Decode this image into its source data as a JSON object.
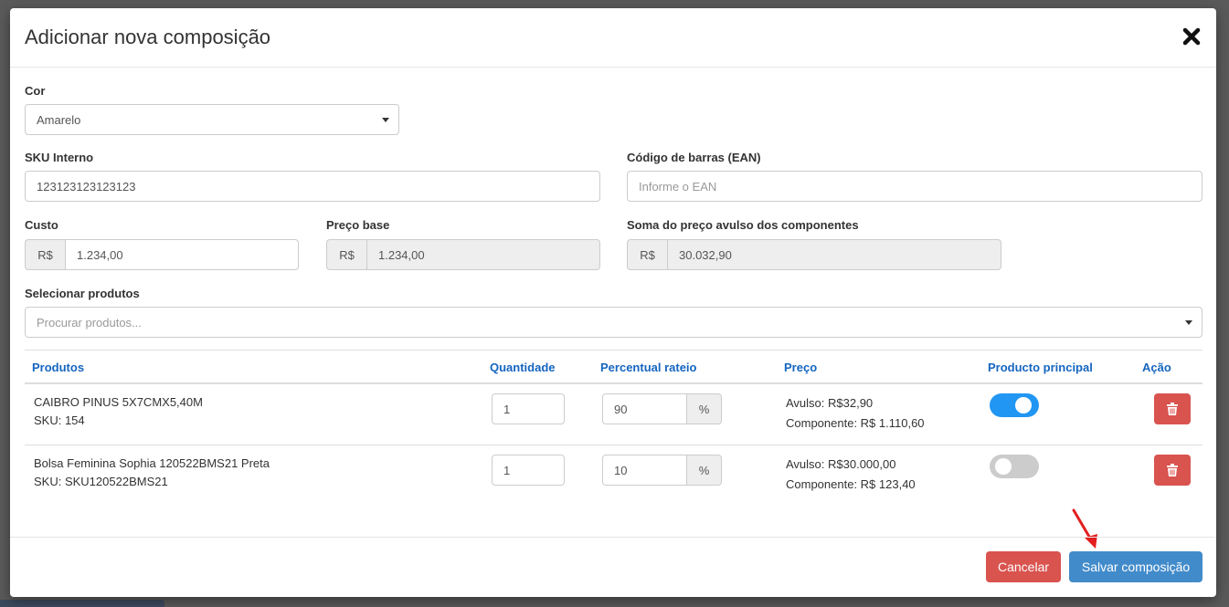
{
  "modal": {
    "title": "Adicionar nova composição"
  },
  "form": {
    "cor": {
      "label": "Cor",
      "value": "Amarelo"
    },
    "sku": {
      "label": "SKU Interno",
      "value": "123123123123123"
    },
    "ean": {
      "label": "Código de barras (EAN)",
      "placeholder": "Informe o EAN"
    },
    "custo": {
      "label": "Custo",
      "prefix": "R$",
      "value": "1.234,00"
    },
    "preco_base": {
      "label": "Preço base",
      "prefix": "R$",
      "value": "1.234,00"
    },
    "soma": {
      "label": "Soma do preço avulso dos componentes",
      "prefix": "R$",
      "value": "30.032,90"
    },
    "produtos": {
      "label": "Selecionar produtos",
      "placeholder": "Procurar produtos..."
    }
  },
  "table": {
    "headers": {
      "produtos": "Produtos",
      "quantidade": "Quantidade",
      "percentual": "Percentual rateio",
      "preco": "Preço",
      "principal": "Producto principal",
      "acao": "Ação"
    },
    "rows": [
      {
        "name": "CAIBRO PINUS 5X7CMX5,40M",
        "sku": "SKU: 154",
        "quantidade": "1",
        "percentual": "90",
        "percent_sign": "%",
        "avulso": "Avulso: R$32,90",
        "componente": "Componente: R$ 1.110,60",
        "principal": true
      },
      {
        "name": "Bolsa Feminina Sophia 120522BMS21 Preta",
        "sku": "SKU: SKU120522BMS21",
        "quantidade": "1",
        "percentual": "10",
        "percent_sign": "%",
        "avulso": "Avulso: R$30.000,00",
        "componente": "Componente: R$ 123,40",
        "principal": false
      }
    ]
  },
  "footer": {
    "cancel_label": "Cancelar",
    "save_label": "Salvar composição"
  },
  "colors": {
    "accent": "#428bca",
    "danger": "#d9534f",
    "toggle_on": "#2196f3",
    "header_text": "#1565c0",
    "annotation_arrow": "#e41e1e"
  },
  "icons": [
    "close-icon",
    "chevron-down-icon",
    "trash-icon",
    "red-arrow-annotation-icon"
  ]
}
